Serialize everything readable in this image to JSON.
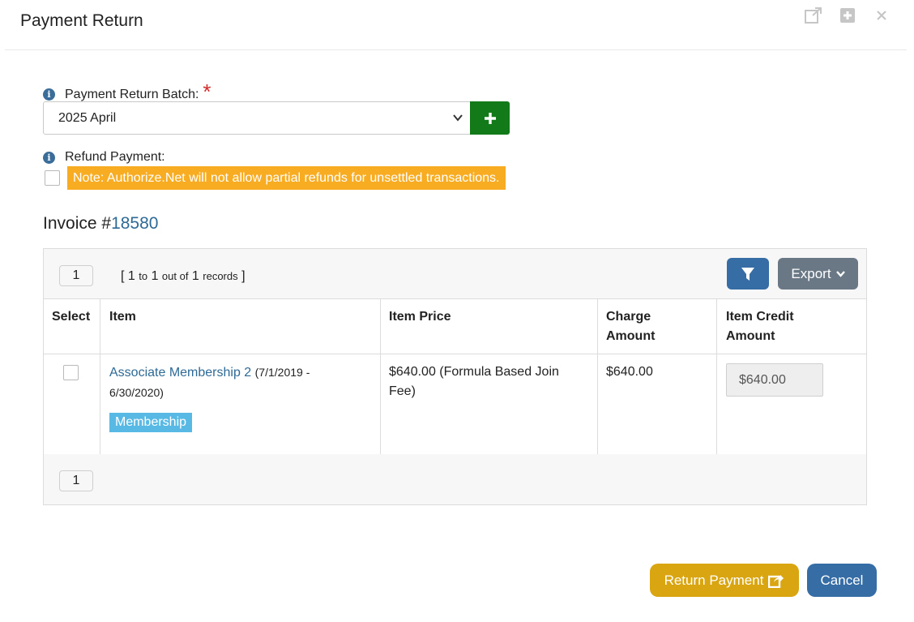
{
  "dialog": {
    "title": "Payment Return"
  },
  "batch": {
    "label": "Payment Return Batch:",
    "required_mark": "*",
    "selected": "2025 April"
  },
  "refund": {
    "label": "Refund Payment:",
    "note": "Note: Authorize.Net will not allow partial refunds for unsettled transactions."
  },
  "invoice": {
    "prefix": "Invoice #",
    "number": "18580"
  },
  "grid": {
    "page": "1",
    "records": {
      "open": "[",
      "from": "1",
      "to_word": "to",
      "to": "1",
      "out_of_word": "out of",
      "total": "1",
      "records_word": "records",
      "close": "]"
    },
    "export_label": "Export",
    "columns": {
      "select": "Select",
      "item": "Item",
      "item_price": "Item Price",
      "charge_amount_1": "Charge",
      "charge_amount_2": "Amount",
      "item_credit_1": "Item Credit",
      "item_credit_2": "Amount"
    },
    "rows": [
      {
        "item_name": "Associate Membership 2",
        "item_dates_1": "(7/1/2019 -",
        "item_dates_2": "6/30/2020)",
        "tag": "Membership",
        "price_1": "$640.00 (Formula Based Join",
        "price_2": "Fee)",
        "charge": "$640.00",
        "credit": "$640.00"
      }
    ],
    "footer_page": "1"
  },
  "buttons": {
    "return_payment": "Return Payment",
    "cancel": "Cancel"
  },
  "colors": {
    "primary": "#366da5",
    "success": "#137a19",
    "warning": "#f7ac22",
    "gold": "#d9a510",
    "tag": "#57b9e4",
    "link": "#2e6a96"
  }
}
